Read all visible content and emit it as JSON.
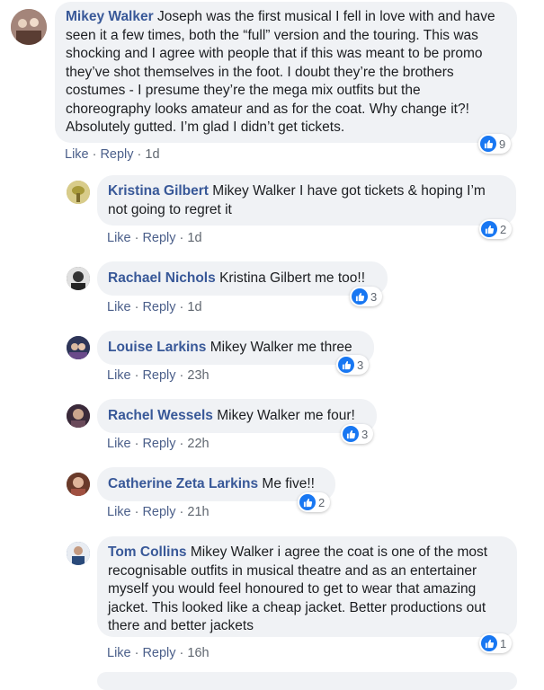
{
  "comments": [
    {
      "author": "Mikey Walker",
      "text": "Joseph was the first musical I fell in love with and have seen it a few times, both the “full” version and the touring. This was shocking and I agree with people that if this was meant to be promo they’ve shot themselves in the foot. I doubt they’re the brothers costumes - I presume they’re the mega mix outfits but the choreography looks amateur and as for the coat. Why change it?! Absolutely gutted. I’m glad I didn’t get tickets.",
      "like": "Like",
      "reply": "Reply",
      "time": "1d",
      "reactions": "9",
      "avatar_color": "#8a6a5a"
    },
    {
      "author": "Kristina Gilbert",
      "text": "Mikey Walker I have got tickets & hoping I’m not going to regret it",
      "like": "Like",
      "reply": "Reply",
      "time": "1d",
      "reactions": "2",
      "avatar_color": "#b8a24a"
    },
    {
      "author": "Rachael Nichols",
      "text": "Kristina Gilbert me too!!",
      "like": "Like",
      "reply": "Reply",
      "time": "1d",
      "reactions": "3",
      "avatar_color": "#555555"
    },
    {
      "author": "Louise Larkins",
      "text": "Mikey Walker me three",
      "like": "Like",
      "reply": "Reply",
      "time": "23h",
      "reactions": "3",
      "avatar_color": "#3a4a7a"
    },
    {
      "author": "Rachel Wessels",
      "text": "Mikey Walker me four!",
      "like": "Like",
      "reply": "Reply",
      "time": "22h",
      "reactions": "3",
      "avatar_color": "#5a3a4a"
    },
    {
      "author": "Catherine Zeta Larkins",
      "text": "Me five!!",
      "like": "Like",
      "reply": "Reply",
      "time": "21h",
      "reactions": "2",
      "avatar_color": "#8a5a4a"
    },
    {
      "author": "Tom Collins",
      "text": "Mikey Walker i agree the coat is one of the most recognisable outfits in musical theatre and as an entertainer myself you would feel honoured to get to wear that amazing jacket. This looked like a cheap jacket. Better productions out there and better jackets",
      "like": "Like",
      "reply": "Reply",
      "time": "16h",
      "reactions": "1",
      "avatar_color": "#4a6a9a"
    }
  ]
}
